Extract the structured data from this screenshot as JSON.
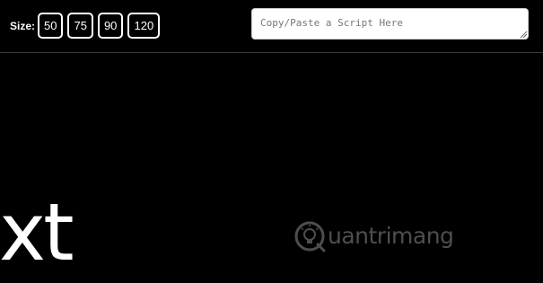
{
  "toolbar": {
    "size_label": "Size:",
    "size_options": [
      "50",
      "75",
      "90",
      "120"
    ],
    "script_input": {
      "value": "",
      "placeholder": "Copy/Paste a Script Here"
    }
  },
  "preview": {
    "text": "xt"
  },
  "watermark": {
    "text": "uantrimang",
    "logo_icon": "lightbulb-q-logo-icon"
  },
  "colors": {
    "background": "#000000",
    "foreground": "#ffffff",
    "divider": "#3a3a3a"
  }
}
